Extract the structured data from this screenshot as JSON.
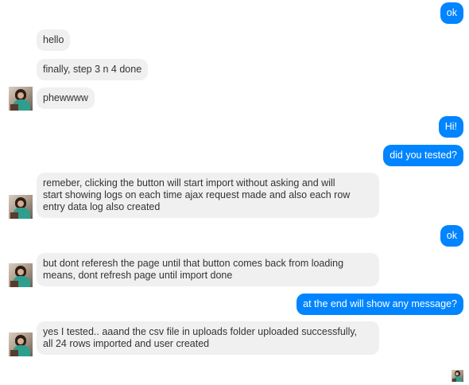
{
  "messages": [
    {
      "text": "ok"
    },
    {
      "text": "hello"
    },
    {
      "text": "finally, step 3 n 4 done"
    },
    {
      "text": "phewwww"
    },
    {
      "text": "Hi!"
    },
    {
      "text": "did you tested?"
    },
    {
      "line1": "remeber, clicking the button will start import without asking and will",
      "line2": "start showing logs on each time ajax request made and also each row",
      "line3": "entry data log also created"
    },
    {
      "text": "ok"
    },
    {
      "line1": "but dont referesh the page until that button comes back from loading",
      "line2": "means, dont refresh page until import done"
    },
    {
      "text": "at the end will show any message?"
    },
    {
      "line1": "yes I tested.. aaand the csv file in uploads folder uploaded successfully,",
      "line2": "all 24 rows imported and user created"
    }
  ],
  "colors": {
    "outgoing": "#0084ff",
    "incoming": "#f1f0f0",
    "outgoing_text": "#ffffff",
    "incoming_text": "#333333"
  },
  "icons": {
    "avatar": "contact-avatar-photo",
    "seen": "seen-avatar-photo"
  }
}
